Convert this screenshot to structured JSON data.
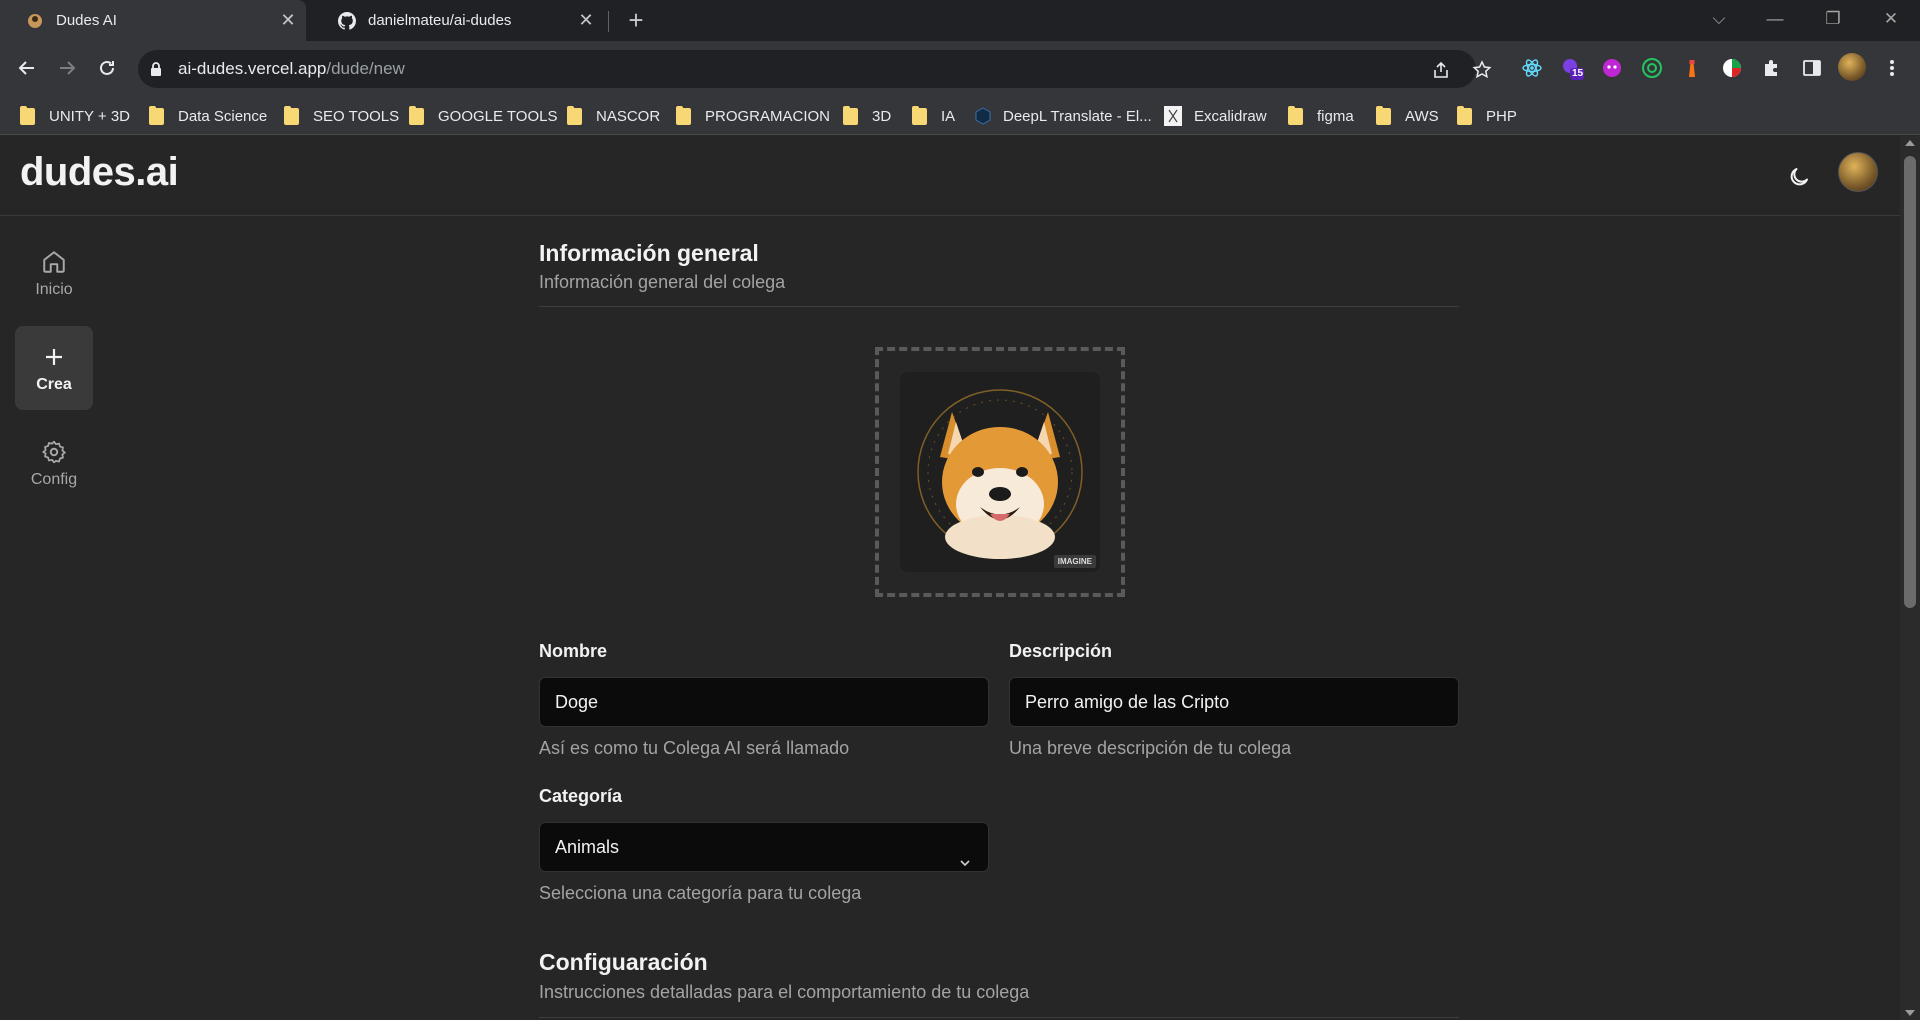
{
  "browser": {
    "tabs": [
      {
        "title": "Dudes AI",
        "icon": "dudes-favicon",
        "active": true
      },
      {
        "title": "danielmateu/ai-dudes",
        "icon": "github-icon",
        "active": false
      }
    ],
    "url_host": "ai-dudes.vercel.app",
    "url_path": "/dude/new",
    "extensions_badge": "15",
    "bookmarks": [
      {
        "label": "UNITY + 3D",
        "icon": "folder-icon"
      },
      {
        "label": "Data Science",
        "icon": "folder-icon"
      },
      {
        "label": "SEO TOOLS",
        "icon": "folder-icon"
      },
      {
        "label": "GOOGLE TOOLS",
        "icon": "folder-icon"
      },
      {
        "label": "NASCOR",
        "icon": "folder-icon"
      },
      {
        "label": "PROGRAMACION",
        "icon": "folder-icon"
      },
      {
        "label": "3D",
        "icon": "folder-icon"
      },
      {
        "label": "IA",
        "icon": "folder-icon"
      },
      {
        "label": "DeepL Translate - El...",
        "icon": "deepl-icon"
      },
      {
        "label": "Excalidraw",
        "icon": "excalidraw-icon"
      },
      {
        "label": "figma",
        "icon": "folder-icon"
      },
      {
        "label": "AWS",
        "icon": "folder-icon"
      },
      {
        "label": "PHP",
        "icon": "folder-icon"
      }
    ]
  },
  "app": {
    "logo": "dudes.ai",
    "nav": [
      {
        "label": "Inicio",
        "icon": "home-icon",
        "active": false
      },
      {
        "label": "Crea",
        "icon": "plus-icon",
        "active": true
      },
      {
        "label": "Config",
        "icon": "gear-icon",
        "active": false
      }
    ]
  },
  "form": {
    "general_title": "Información general",
    "general_subtitle": "Información general del colega",
    "image_badge": "IMAGINE",
    "name_label": "Nombre",
    "name_value": "Doge",
    "name_hint": "Así es como tu Colega AI será llamado",
    "description_label": "Descripción",
    "description_value": "Perro amigo de las Cripto",
    "description_hint": "Una breve descripción de tu colega",
    "category_label": "Categoría",
    "category_value": "Animals",
    "category_hint": "Selecciona una categoría para tu colega",
    "config_title": "Configuaración",
    "config_subtitle": "Instrucciones detalladas para el comportamiento de tu colega"
  },
  "colors": {
    "background": "#262626",
    "input_bg": "#0b0b0b",
    "text": "#f2f2f2",
    "muted": "#a3a3a3"
  }
}
